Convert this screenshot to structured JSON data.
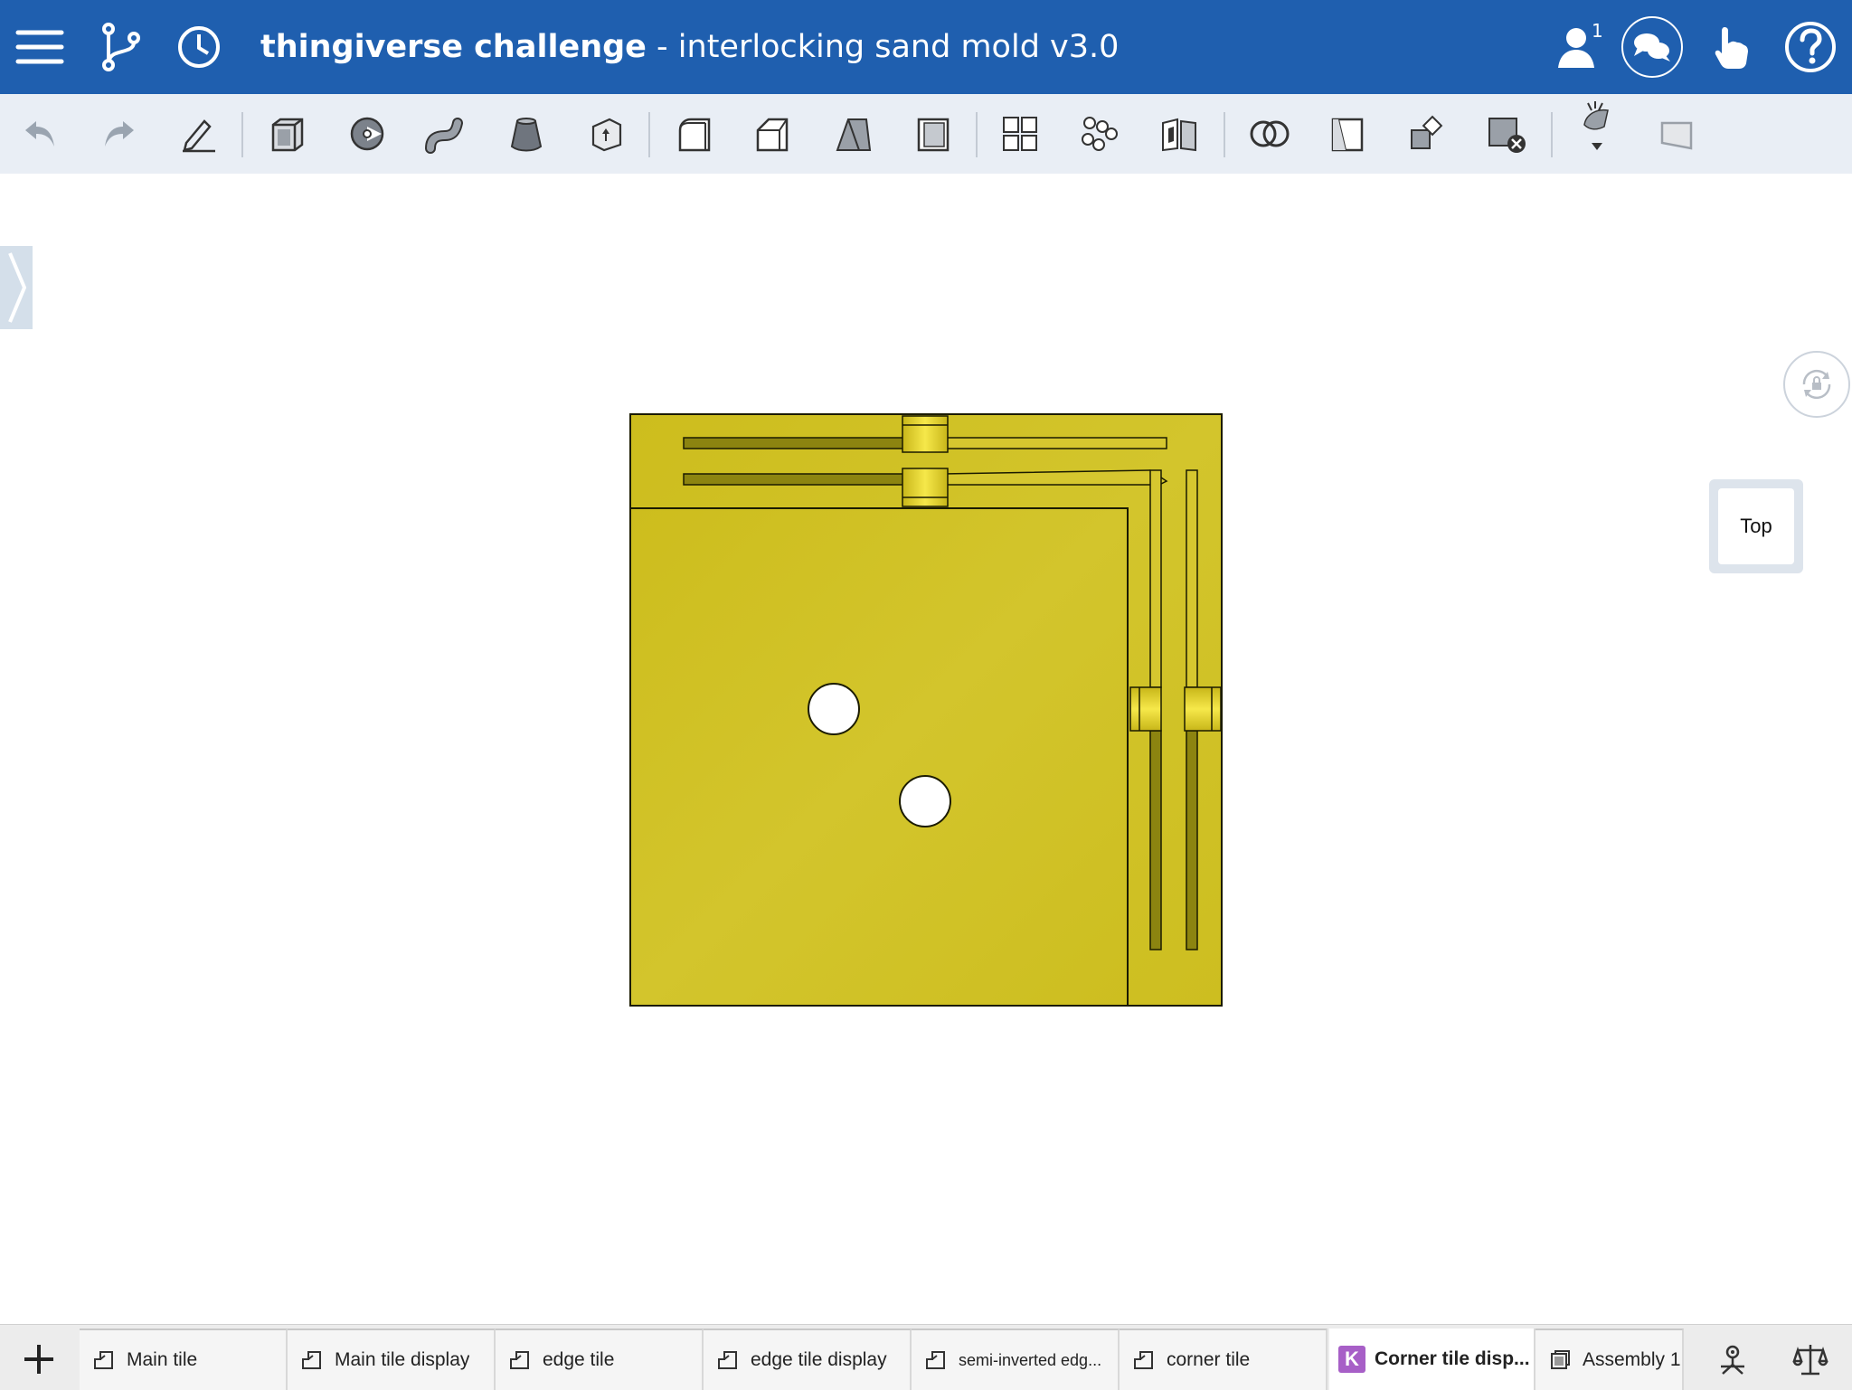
{
  "header": {
    "title_bold": "thingiverse challenge",
    "title_sep": " - ",
    "title_rest": "interlocking sand mold v3.0",
    "users_count": "1",
    "colors": {
      "bar": "#1f5faf",
      "text": "#ffffff"
    },
    "icons": [
      "menu-icon",
      "branch-icon",
      "history-icon",
      "user-icon",
      "comments-icon",
      "touch-icon",
      "help-icon"
    ]
  },
  "toolbar": {
    "icons": [
      "undo-icon",
      "redo-icon",
      "sketch-icon",
      "extrude-icon",
      "revolve-icon",
      "sweep-icon",
      "loft-icon",
      "thicken-icon",
      "fillet-icon",
      "chamfer-icon",
      "draft-icon",
      "shell-icon",
      "pattern-icon",
      "mirror-icon",
      "split-icon",
      "boolean-icon",
      "plane-icon",
      "transform-icon",
      "delete-part-icon",
      "appearance-icon",
      "section-view-icon"
    ]
  },
  "viewport": {
    "view_cube_label": "Top",
    "model_color": "#cfc223"
  },
  "tabs": [
    {
      "label": "Main tile",
      "icon": "part-studio-icon"
    },
    {
      "label": "Main tile display",
      "icon": "part-studio-icon"
    },
    {
      "label": "edge tile",
      "icon": "part-studio-icon"
    },
    {
      "label": "edge tile display",
      "icon": "part-studio-icon"
    },
    {
      "label": "semi-inverted edg...",
      "icon": "part-studio-icon"
    },
    {
      "label": "corner tile",
      "icon": "part-studio-icon"
    },
    {
      "label": "Corner tile disp...",
      "icon": "k-badge-icon",
      "badge": "K",
      "active": true
    },
    {
      "label": "Assembly 1",
      "icon": "assembly-icon"
    }
  ],
  "tabbar": {
    "add_icon": "plus-icon",
    "right_icons": [
      "robot-icon",
      "balance-icon"
    ]
  }
}
